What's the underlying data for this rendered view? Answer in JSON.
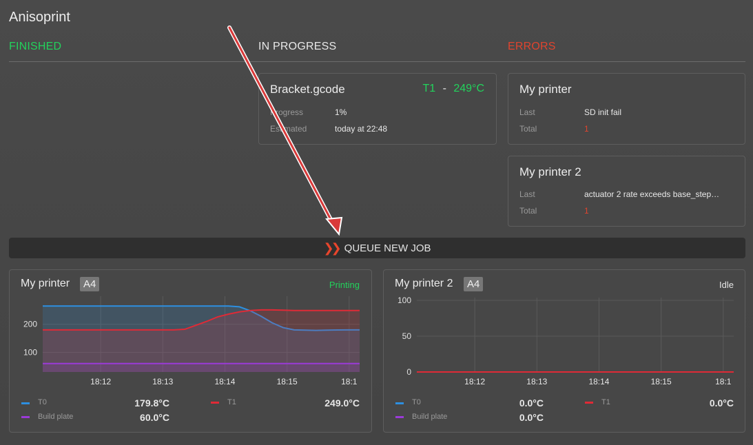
{
  "app": {
    "title": "Anisoprint"
  },
  "columns": {
    "finished": "FINISHED",
    "in_progress": "IN PROGRESS",
    "errors": "ERRORS"
  },
  "colors": {
    "finished": "#22d35c",
    "errors": "#e0442e",
    "accent": "#e8452c"
  },
  "job": {
    "file": "Bracket.gcode",
    "tool": "T1",
    "sep": "-",
    "temp": "249°C",
    "progress_label": "Progress",
    "progress_value": "1%",
    "estimated_label": "Estimated",
    "estimated_value": "today at 22:48"
  },
  "errors": [
    {
      "name": "My printer",
      "last_label": "Last",
      "last_value": "SD init fail",
      "total_label": "Total",
      "total_value": "1"
    },
    {
      "name": "My printer 2",
      "last_label": "Last",
      "last_value": "actuator 2 rate exceeds base_step…",
      "total_label": "Total",
      "total_value": "1"
    }
  ],
  "queue": {
    "label": "QUEUE NEW JOB",
    "icon": "double-chevron-right-icon"
  },
  "printers": [
    {
      "name": "My printer",
      "size": "A4",
      "status": "Printing",
      "status_color": "#22d35c",
      "legend": [
        {
          "key": "T0",
          "value": "179.8°C",
          "color": "#2d8fe0"
        },
        {
          "key": "T1",
          "value": "249.0°C",
          "color": "#e02a36"
        },
        {
          "key": "Build plate",
          "value": "60.0°C",
          "color": "#9b3ad8"
        }
      ]
    },
    {
      "name": "My printer 2",
      "size": "A4",
      "status": "Idle",
      "status_color": "#e6e6e6",
      "legend": [
        {
          "key": "T0",
          "value": "0.0°C",
          "color": "#2d8fe0"
        },
        {
          "key": "T1",
          "value": "0.0°C",
          "color": "#e02a36"
        },
        {
          "key": "Build plate",
          "value": "0.0°C",
          "color": "#9b3ad8"
        }
      ]
    }
  ],
  "chart_data": [
    {
      "type": "line",
      "x_ticks": [
        "18:12",
        "18:13",
        "18:14",
        "18:15",
        "18:1"
      ],
      "y_ticks": [
        "200",
        "100"
      ],
      "ylim": [
        30,
        290
      ],
      "x": [
        18.1,
        18.2,
        18.3,
        18.4,
        18.5,
        18.6,
        18.7,
        18.8,
        18.9,
        19.0,
        19.1,
        19.2,
        19.3,
        19.4,
        19.5,
        19.6,
        19.7,
        19.8,
        19.9,
        20.0,
        20.1,
        20.2,
        20.3,
        20.4,
        20.5,
        20.6,
        20.7,
        20.8,
        20.9,
        21.0
      ],
      "series": [
        {
          "name": "T0",
          "color": "#2d8fe0",
          "fill": true,
          "values": [
            265,
            265,
            265,
            265,
            265,
            265,
            265,
            265,
            265,
            265,
            265,
            265,
            265,
            265,
            265,
            265,
            265,
            265,
            262,
            248,
            228,
            205,
            188,
            180,
            179,
            178,
            179,
            179.5,
            179.8,
            179.8
          ]
        },
        {
          "name": "T1",
          "color": "#e02a36",
          "fill": true,
          "values": [
            180,
            180,
            180,
            180,
            180,
            180,
            180,
            180,
            180,
            180,
            180,
            180,
            180,
            182,
            196,
            210,
            226,
            236,
            244,
            249,
            251,
            251,
            250,
            249,
            249,
            249,
            249,
            249,
            249,
            249
          ]
        },
        {
          "name": "Build plate",
          "color": "#9b3ad8",
          "fill": true,
          "values": [
            60,
            60,
            60,
            60,
            60,
            60,
            60,
            60,
            60,
            60,
            60,
            60,
            60,
            60,
            60,
            60,
            60,
            60,
            60,
            60,
            60,
            60,
            60,
            60,
            60,
            60,
            60,
            60,
            60,
            60
          ]
        }
      ]
    },
    {
      "type": "line",
      "x_ticks": [
        "18:12",
        "18:13",
        "18:14",
        "18:15",
        "18:1"
      ],
      "y_ticks": [
        "100",
        "50",
        "0"
      ],
      "ylim": [
        0,
        100
      ],
      "x": [
        18.0,
        21.0
      ],
      "series": [
        {
          "name": "T1",
          "color": "#e02a36",
          "values": [
            0,
            0
          ]
        }
      ]
    }
  ]
}
